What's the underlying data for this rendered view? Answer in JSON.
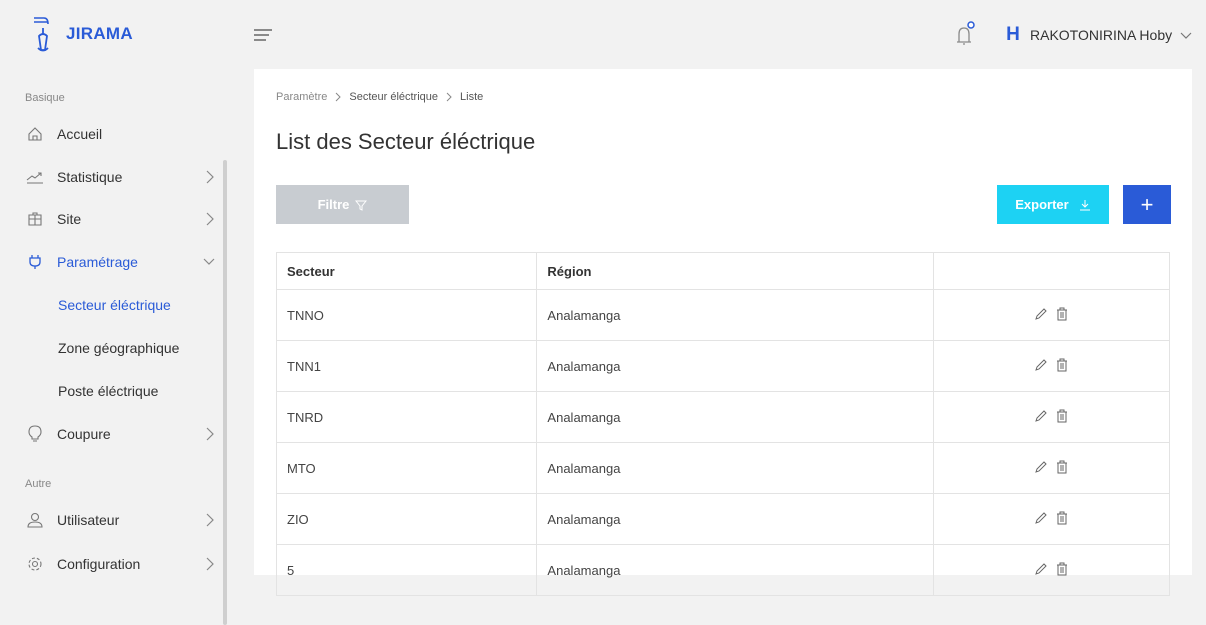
{
  "app": {
    "brand": "JIRAMA"
  },
  "header": {
    "user_initial": "H",
    "user_name": "RAKOTONIRINA Hoby"
  },
  "sidebar": {
    "section_basic": "Basique",
    "section_other": "Autre",
    "items": [
      {
        "label": "Accueil",
        "icon": "home-icon"
      },
      {
        "label": "Statistique",
        "icon": "trend-icon"
      },
      {
        "label": "Site",
        "icon": "site-icon"
      },
      {
        "label": "Paramétrage",
        "icon": "plug-icon"
      },
      {
        "label": "Coupure",
        "icon": "bulb-icon"
      },
      {
        "label": "Utilisateur",
        "icon": "user-icon"
      },
      {
        "label": "Configuration",
        "icon": "gear-icon"
      }
    ],
    "sub_items": [
      {
        "label": "Secteur éléctrique"
      },
      {
        "label": "Zone géographique"
      },
      {
        "label": "Poste éléctrique"
      }
    ]
  },
  "breadcrumb": [
    "Paramètre",
    "Secteur éléctrique",
    "Liste"
  ],
  "page": {
    "title": "List des Secteur éléctrique"
  },
  "toolbar": {
    "filter_label": "Filtre",
    "export_label": "Exporter",
    "add_label": "+"
  },
  "table": {
    "headers": [
      "Secteur",
      "Région",
      ""
    ],
    "rows": [
      [
        "TNNO",
        "Analamanga"
      ],
      [
        "TNN1",
        "Analamanga"
      ],
      [
        "TNRD",
        "Analamanga"
      ],
      [
        "MTO",
        "Analamanga"
      ],
      [
        "ZIO",
        "Analamanga"
      ],
      [
        "5",
        "Analamanga"
      ]
    ]
  },
  "colors": {
    "accent": "#2a5bd7",
    "export": "#1dd2f3",
    "filter": "#c8ccd1",
    "background": "#f2f2f2"
  }
}
